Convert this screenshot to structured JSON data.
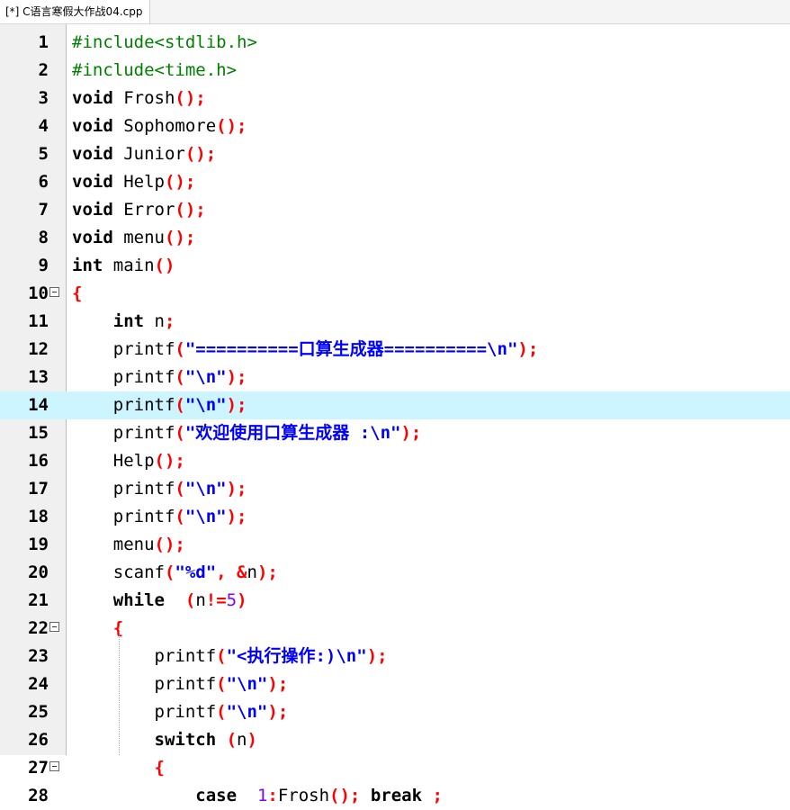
{
  "tab": {
    "label": "[*] C语言寒假大作战04.cpp"
  },
  "highlight_line": 14,
  "lines": [
    {
      "n": "1",
      "fold": false,
      "tokens": [
        [
          "pp",
          "#include<stdlib.h>"
        ]
      ]
    },
    {
      "n": "2",
      "fold": false,
      "tokens": [
        [
          "pp",
          "#include<time.h>"
        ]
      ]
    },
    {
      "n": "3",
      "fold": false,
      "tokens": [
        [
          "kw",
          "void"
        ],
        [
          "",
          "Frosh"
        ],
        [
          "sym",
          "();"
        ]
      ]
    },
    {
      "n": "4",
      "fold": false,
      "tokens": [
        [
          "kw",
          "void"
        ],
        [
          "",
          "Sophomore"
        ],
        [
          "sym",
          "();"
        ]
      ]
    },
    {
      "n": "5",
      "fold": false,
      "tokens": [
        [
          "kw",
          "void"
        ],
        [
          "",
          "Junior"
        ],
        [
          "sym",
          "();"
        ]
      ]
    },
    {
      "n": "6",
      "fold": false,
      "tokens": [
        [
          "kw",
          "void"
        ],
        [
          "",
          "Help"
        ],
        [
          "sym",
          "();"
        ]
      ]
    },
    {
      "n": "7",
      "fold": false,
      "tokens": [
        [
          "kw",
          "void"
        ],
        [
          "",
          "Error"
        ],
        [
          "sym",
          "();"
        ]
      ]
    },
    {
      "n": "8",
      "fold": false,
      "tokens": [
        [
          "kw",
          "void"
        ],
        [
          "",
          "menu"
        ],
        [
          "sym",
          "();"
        ]
      ]
    },
    {
      "n": "9",
      "fold": false,
      "tokens": [
        [
          "kw",
          "int"
        ],
        [
          "",
          "main"
        ],
        [
          "sym",
          "()"
        ]
      ]
    },
    {
      "n": "10",
      "fold": true,
      "tokens": [
        [
          "sym",
          "{"
        ]
      ]
    },
    {
      "n": "11",
      "fold": false,
      "tokens": [
        [
          "",
          "    "
        ],
        [
          "kw",
          "int"
        ],
        [
          "",
          "n"
        ],
        [
          "sym",
          ";"
        ]
      ]
    },
    {
      "n": "12",
      "fold": false,
      "tokens": [
        [
          "",
          "    printf"
        ],
        [
          "sym",
          "("
        ],
        [
          "str",
          "\"==========口算生成器==========\\n\""
        ],
        [
          "sym",
          ");"
        ]
      ]
    },
    {
      "n": "13",
      "fold": false,
      "tokens": [
        [
          "",
          "    printf"
        ],
        [
          "sym",
          "("
        ],
        [
          "str",
          "\"\\n\""
        ],
        [
          "sym",
          ");"
        ]
      ]
    },
    {
      "n": "14",
      "fold": false,
      "tokens": [
        [
          "",
          "    printf"
        ],
        [
          "sym",
          "("
        ],
        [
          "str",
          "\"\\n\""
        ],
        [
          "sym",
          ");"
        ]
      ]
    },
    {
      "n": "15",
      "fold": false,
      "tokens": [
        [
          "",
          "    printf"
        ],
        [
          "sym",
          "("
        ],
        [
          "str",
          "\"欢迎使用口算生成器 :\\n\""
        ],
        [
          "sym",
          ");"
        ]
      ]
    },
    {
      "n": "16",
      "fold": false,
      "tokens": [
        [
          "",
          "    Help"
        ],
        [
          "sym",
          "();"
        ]
      ]
    },
    {
      "n": "17",
      "fold": false,
      "tokens": [
        [
          "",
          "    printf"
        ],
        [
          "sym",
          "("
        ],
        [
          "str",
          "\"\\n\""
        ],
        [
          "sym",
          ");"
        ]
      ]
    },
    {
      "n": "18",
      "fold": false,
      "tokens": [
        [
          "",
          "    printf"
        ],
        [
          "sym",
          "("
        ],
        [
          "str",
          "\"\\n\""
        ],
        [
          "sym",
          ");"
        ]
      ]
    },
    {
      "n": "19",
      "fold": false,
      "tokens": [
        [
          "",
          "    menu"
        ],
        [
          "sym",
          "();"
        ]
      ]
    },
    {
      "n": "20",
      "fold": false,
      "tokens": [
        [
          "",
          "    scanf"
        ],
        [
          "sym",
          "("
        ],
        [
          "str",
          "\"%d\""
        ],
        [
          "sym",
          ", &"
        ],
        [
          "",
          "n"
        ],
        [
          "sym",
          ");"
        ]
      ]
    },
    {
      "n": "21",
      "fold": false,
      "tokens": [
        [
          "",
          "    "
        ],
        [
          "kw",
          "while"
        ],
        [
          "",
          " "
        ],
        [
          "sym",
          "("
        ],
        [
          "",
          "n"
        ],
        [
          "sym",
          "!="
        ],
        [
          "num",
          "5"
        ],
        [
          "sym",
          ")"
        ]
      ]
    },
    {
      "n": "22",
      "fold": true,
      "tokens": [
        [
          "",
          "    "
        ],
        [
          "sym",
          "{"
        ]
      ]
    },
    {
      "n": "23",
      "fold": false,
      "tokens": [
        [
          "",
          "        printf"
        ],
        [
          "sym",
          "("
        ],
        [
          "str",
          "\"<执行操作:)\\n\""
        ],
        [
          "sym",
          ");"
        ]
      ]
    },
    {
      "n": "24",
      "fold": false,
      "tokens": [
        [
          "",
          "        printf"
        ],
        [
          "sym",
          "("
        ],
        [
          "str",
          "\"\\n\""
        ],
        [
          "sym",
          ");"
        ]
      ]
    },
    {
      "n": "25",
      "fold": false,
      "tokens": [
        [
          "",
          "        printf"
        ],
        [
          "sym",
          "("
        ],
        [
          "str",
          "\"\\n\""
        ],
        [
          "sym",
          ");"
        ]
      ]
    },
    {
      "n": "26",
      "fold": false,
      "tokens": [
        [
          "",
          "        "
        ],
        [
          "kw",
          "switch"
        ],
        [
          "sym",
          "("
        ],
        [
          "",
          "n"
        ],
        [
          "sym",
          ")"
        ]
      ]
    },
    {
      "n": "27",
      "fold": true,
      "tokens": [
        [
          "",
          "        "
        ],
        [
          "sym",
          "{"
        ]
      ]
    },
    {
      "n": "28",
      "fold": false,
      "tokens": [
        [
          "",
          "            "
        ],
        [
          "kw",
          "case"
        ],
        [
          "",
          " "
        ],
        [
          "num",
          "1"
        ],
        [
          "sym",
          ":"
        ],
        [
          "",
          "Frosh"
        ],
        [
          "sym",
          "();"
        ],
        [
          "",
          " "
        ],
        [
          "kw",
          "break"
        ],
        [
          "sym",
          ";"
        ]
      ]
    }
  ]
}
